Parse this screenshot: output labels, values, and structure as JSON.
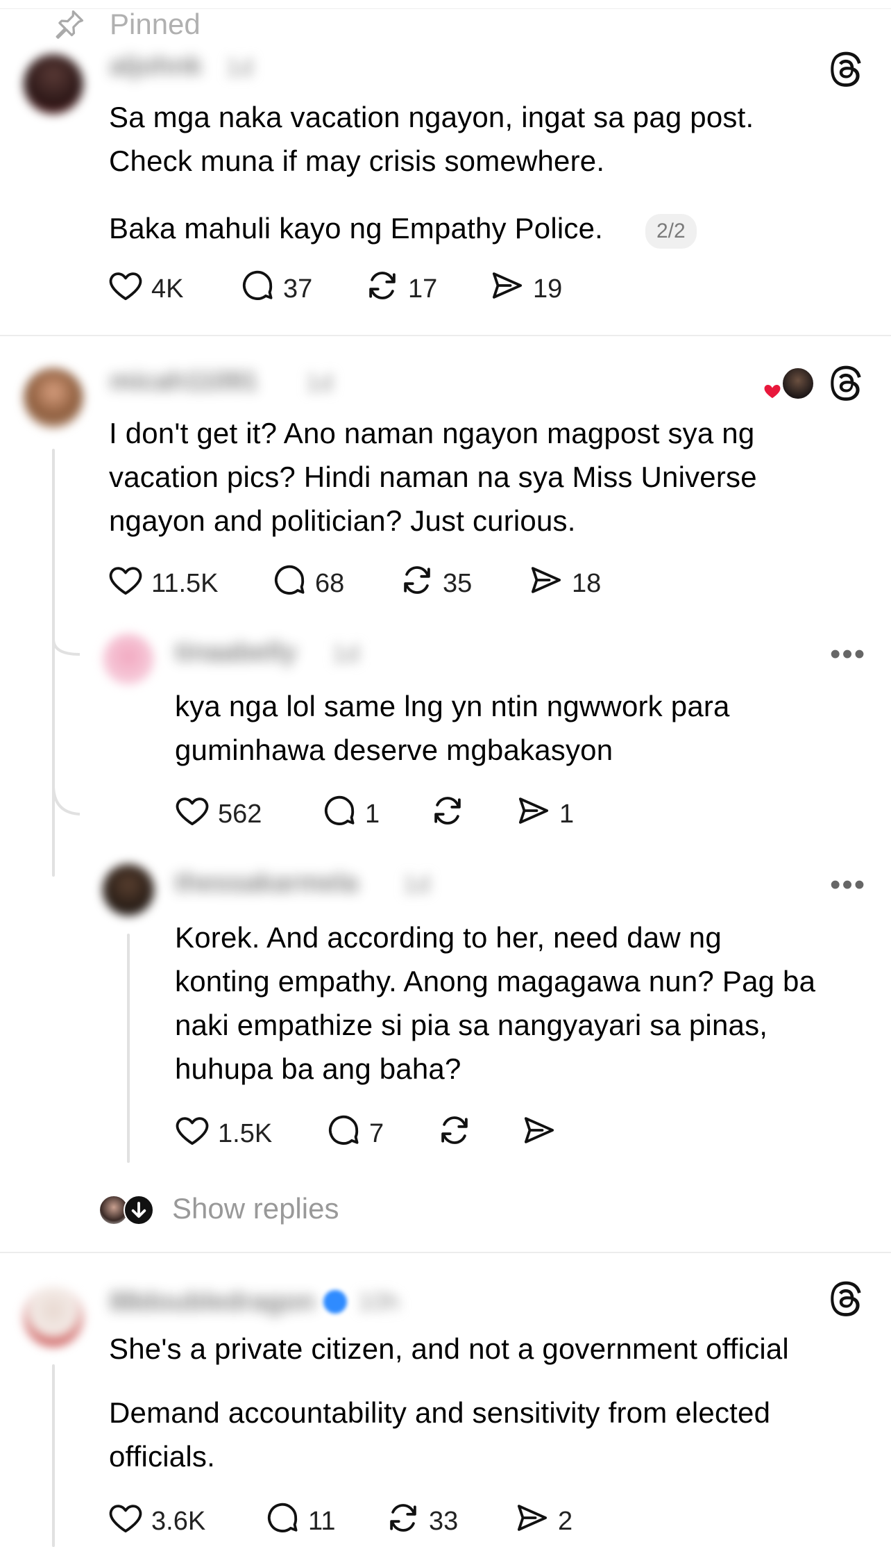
{
  "pinned": {
    "label": "Pinned"
  },
  "posts": [
    {
      "username": "aljohnk",
      "time": "1d",
      "text": "Sa mga naka vacation ngayon, ingat sa pag post.\nCheck muna if may crisis somewhere.",
      "text2": "Baka mahuli kayo ng Empathy Police.",
      "page_badge": "2/2",
      "likes": "4K",
      "replies": "37",
      "reposts": "17",
      "shares": "19"
    },
    {
      "username": "micah11091",
      "time": "1d",
      "text": "I don't get it? Ano naman ngayon magpost sya ng\nvacation pics? Hindi naman na sya Miss Universe\nngayon and politician? Just curious.",
      "likes": "11.5K",
      "replies": "68",
      "reposts": "35",
      "shares": "18"
    },
    {
      "username": "tinaabelly",
      "time": "1d",
      "text": "kya nga lol same lng yn ntin ngwwork para\nguminhawa deserve mgbakasyon",
      "likes": "562",
      "replies": "1",
      "reposts": "",
      "shares": "1"
    },
    {
      "username": "thessakarmela",
      "time": "1d",
      "text": "Korek. And according to her, need daw ng\nkonting empathy. Anong magagawa nun? Pag ba\nnaki empathize si pia sa nangyayari sa pinas,\nhuhupa ba ang baha?",
      "likes": "1.5K",
      "replies": "7",
      "reposts": "",
      "shares": ""
    },
    {
      "username": "88doubledragon",
      "time": "10h",
      "text": "She's a private citizen, and not a government official",
      "text2": "Demand accountability and sensitivity from elected\nofficials.",
      "likes": "3.6K",
      "replies": "11",
      "reposts": "33",
      "shares": "2"
    }
  ],
  "show_replies": {
    "label": "Show replies"
  },
  "icons": {
    "pin": "pin-icon",
    "like": "heart-icon",
    "reply": "comment-icon",
    "repost": "repost-icon",
    "share": "send-icon",
    "threads": "threads-logo-icon",
    "more": "more-icon"
  },
  "colors": {
    "verified": "#2f8bff",
    "like_heart": "#e8173b",
    "muted": "#999999"
  }
}
